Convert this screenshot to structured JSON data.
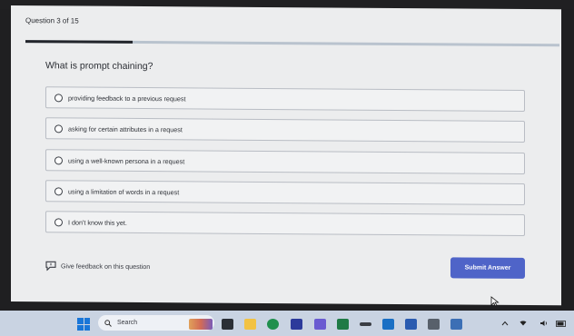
{
  "quiz": {
    "counter": "Question 3 of 15",
    "progress": 0.2,
    "question": "What is prompt chaining?",
    "options": [
      "providing feedback to a previous request",
      "asking for certain attributes in a request",
      "using a well-known persona in a request",
      "using a limitation of words in a request",
      "I don't know this yet."
    ],
    "feedback_label": "Give feedback on this question",
    "submit_label": "Submit Answer"
  },
  "taskbar": {
    "search_placeholder": "Search",
    "pinned_icons": [
      "widgets-icon",
      "file-explorer-icon",
      "chrome-icon",
      "store-icon",
      "teams-icon",
      "excel-icon",
      "pen-icon",
      "outlook-icon",
      "word-icon",
      "calculator-icon",
      "snipping-icon"
    ],
    "tray_icons": [
      "chevron-up-icon",
      "wifi-icon",
      "volume-icon",
      "battery-icon"
    ]
  },
  "colors": {
    "accent": "#4f64c8",
    "page_bg": "#ecedee",
    "taskbar_bg": "#c9d3e2"
  }
}
